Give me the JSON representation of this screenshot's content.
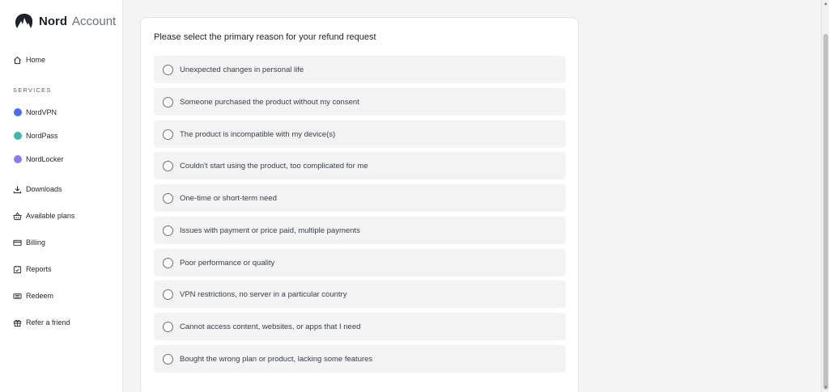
{
  "brand": {
    "name": "Nord",
    "sub": "Account"
  },
  "sidebar": {
    "home": "Home",
    "services_label": "SERVICES",
    "services": [
      {
        "label": "NordVPN",
        "color": "#4a6cf7"
      },
      {
        "label": "NordPass",
        "color": "#3fb6a8"
      },
      {
        "label": "NordLocker",
        "color": "#8c7bf0"
      }
    ],
    "items": [
      {
        "label": "Downloads",
        "icon": "download-icon"
      },
      {
        "label": "Available plans",
        "icon": "basket-icon"
      },
      {
        "label": "Billing",
        "icon": "card-icon"
      },
      {
        "label": "Reports",
        "icon": "report-icon"
      },
      {
        "label": "Redeem",
        "icon": "ticket-icon"
      },
      {
        "label": "Refer a friend",
        "icon": "gift-icon"
      }
    ]
  },
  "refund": {
    "title": "Please select the primary reason for your refund request",
    "options": [
      "Unexpected changes in personal life",
      "Someone purchased the product without my consent",
      "The product is incompatible with my device(s)",
      "Couldn't start using the product, too complicated for me",
      "One-time or short-term need",
      "Issues with payment or price paid, multiple payments",
      "Poor performance or quality",
      "VPN restrictions, no server in a particular country",
      "Cannot access content, websites, or apps that I need",
      "Bought the wrong plan or product, lacking some features"
    ]
  }
}
